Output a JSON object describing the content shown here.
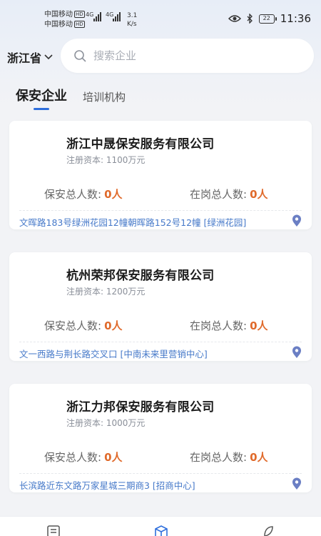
{
  "status_bar": {
    "carrier_1": "中国移动",
    "carrier_2": "中国移动",
    "hd_badge": "HD",
    "network_1": "4G",
    "network_2": "4G",
    "speed_value": "3.1",
    "speed_unit": "K/s",
    "battery": "22",
    "time": "11:36"
  },
  "header": {
    "province": "浙江省",
    "search_placeholder": "搜索企业"
  },
  "tabs": [
    {
      "label": "保安企业",
      "active": true
    },
    {
      "label": "培训机构",
      "active": false
    }
  ],
  "labels": {
    "guards_total": "保安总人数:",
    "on_duty_total": "在岗总人数:"
  },
  "companies": [
    {
      "name": "浙江中晟保安服务有限公司",
      "capital": "注册资本: 1100万元",
      "guards": "0人",
      "on_duty": "0人",
      "address": "文晖路183号绿洲花园12幢朝晖路152号12幢 [绿洲花园]"
    },
    {
      "name": "杭州荣邦保安服务有限公司",
      "capital": "注册资本: 1200万元",
      "guards": "0人",
      "on_duty": "0人",
      "address": "文一西路与荆长路交叉口 [中南未来里营销中心]"
    },
    {
      "name": "浙江力邦保安服务有限公司",
      "capital": "注册资本: 1000万元",
      "guards": "0人",
      "on_duty": "0人",
      "address": "长滨路近东文路万家星城三期商3 [招商中心]"
    }
  ],
  "colors": {
    "accent": "#2f6fdc",
    "number": "#e06a2b",
    "address": "#4679c9",
    "pin": "#6b7fc4"
  },
  "icons": {
    "search": "search-icon",
    "dropdown": "chevron-down-icon",
    "location": "location-pin-icon",
    "nav_list": "list-icon",
    "nav_box": "box-icon",
    "nav_leaf": "leaf-icon"
  }
}
